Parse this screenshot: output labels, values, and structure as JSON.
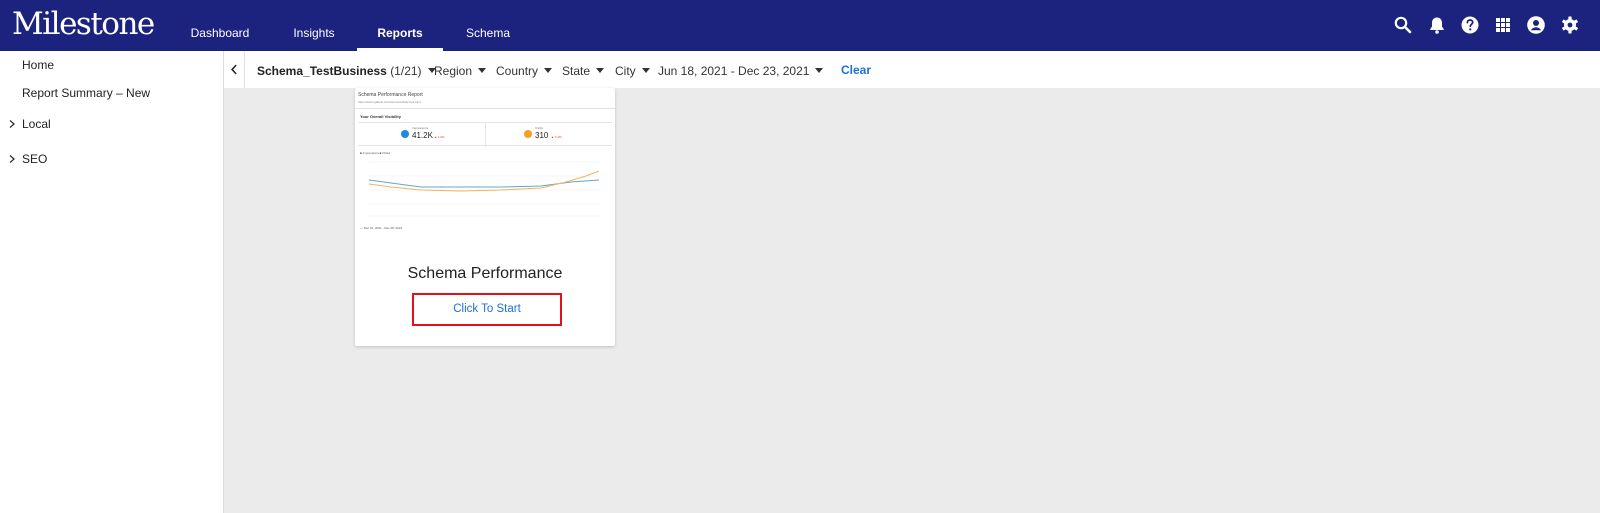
{
  "app": {
    "logo": "Milestone"
  },
  "nav": {
    "tabs": [
      {
        "label": "Dashboard"
      },
      {
        "label": "Insights"
      },
      {
        "label": "Reports",
        "active": true
      },
      {
        "label": "Schema"
      }
    ]
  },
  "top_icons": [
    "search-icon",
    "bell-icon",
    "help-icon",
    "apps-grid-icon",
    "account-icon",
    "settings-gear-icon"
  ],
  "sidebar": {
    "items": [
      {
        "label": "Home",
        "expandable": false
      },
      {
        "label": "Report Summary – New",
        "expandable": false
      },
      {
        "label": "Local",
        "expandable": true
      },
      {
        "label": "SEO",
        "expandable": true
      }
    ]
  },
  "filters": {
    "business": "Schema_TestBusiness",
    "business_count": "(1/21)",
    "region": "Region",
    "country": "Country",
    "state": "State",
    "city": "City",
    "date_range": "Jun 18, 2021 - Dec 23, 2021",
    "clear_label": "Clear"
  },
  "card": {
    "thumbnail": {
      "title": "Schema Performance Report",
      "url": "https://www.gabelo.com/services/daily-tips.html",
      "section": "Your Overall Visibility",
      "kpis": [
        {
          "label": "Impressions",
          "value": "41.2K",
          "delta": "▲ 4.0%",
          "color": "#1e88e5"
        },
        {
          "label": "Clicks",
          "value": "310",
          "delta": "▲ 3.4%",
          "color": "#f4a021"
        }
      ],
      "legend": "■ Impressions  ■ Clicks",
      "date_range": "— Dec 01, 2021 - Dec 28, 2021"
    },
    "title": "Schema Performance",
    "button_label": "Click To Start"
  },
  "colors": {
    "topbar": "#1b237f",
    "accent": "#1e6fd9",
    "highlight": "#e0131b",
    "line_blue": "#5aa9d6",
    "line_orange": "#f6b25a"
  }
}
